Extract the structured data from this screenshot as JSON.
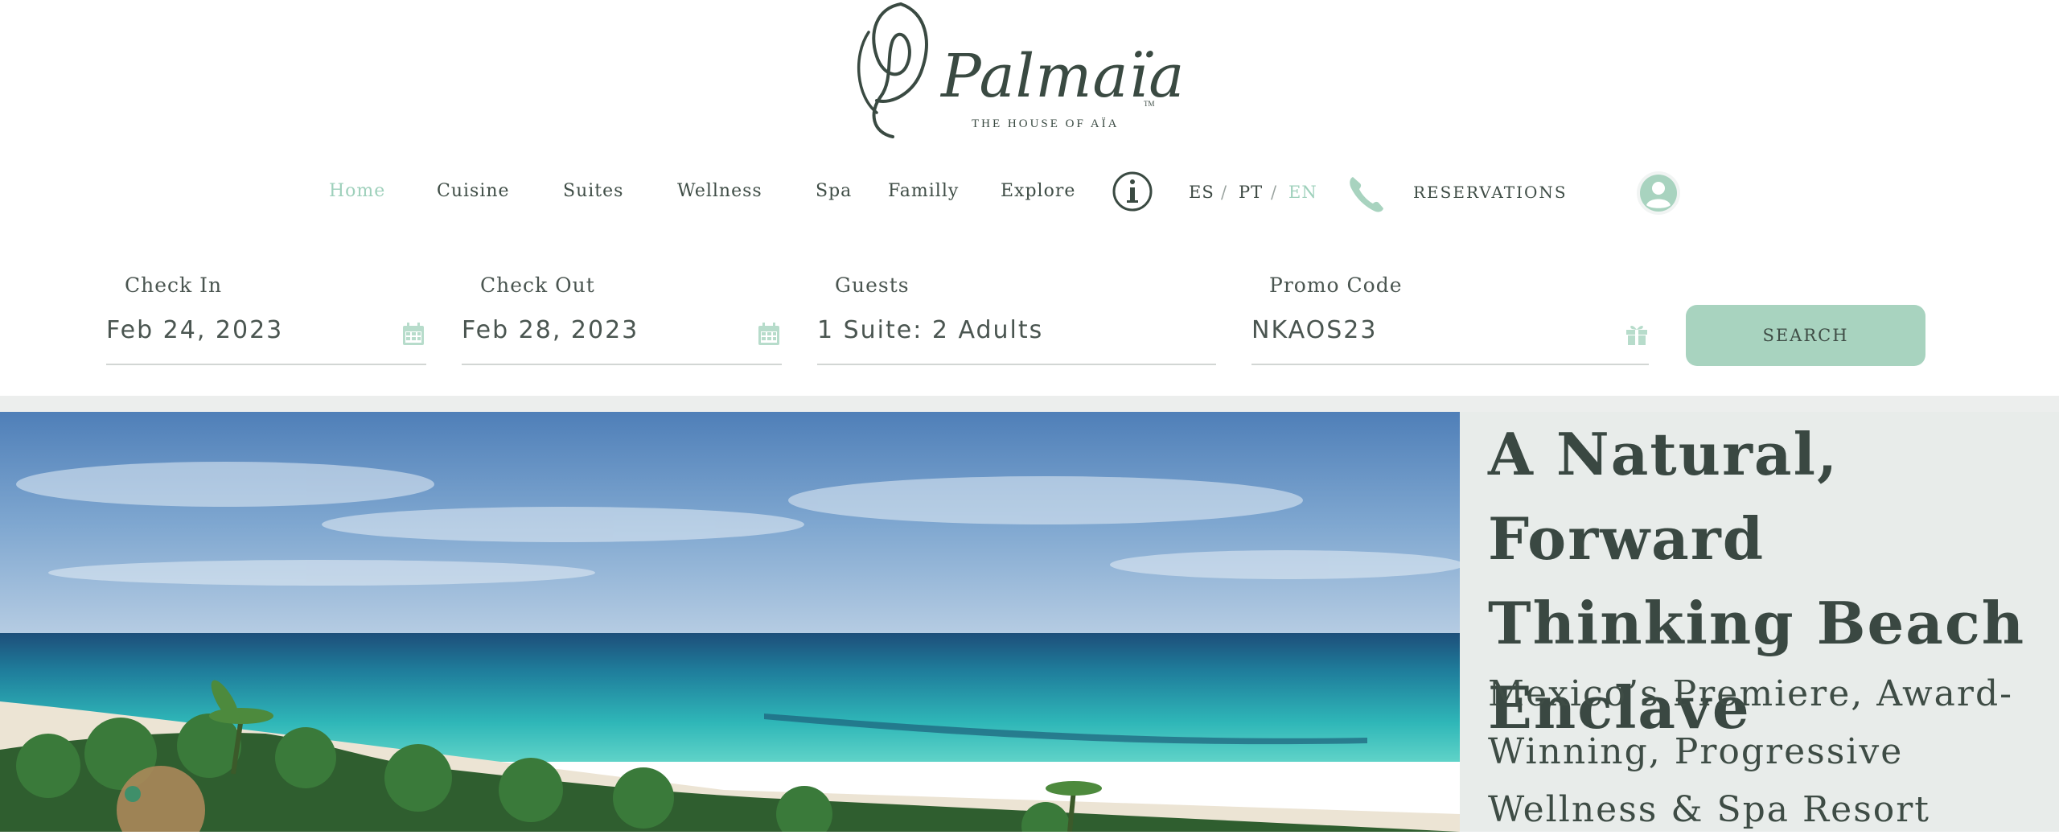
{
  "brand": {
    "logo_text": "Palmaïa",
    "tagline": "THE HOUSE OF AÏA",
    "trademark": "TM"
  },
  "nav": {
    "items": [
      {
        "label": "Home",
        "active": true
      },
      {
        "label": "Cuisine"
      },
      {
        "label": "Suites"
      },
      {
        "label": "Wellness"
      },
      {
        "label": "Spa"
      },
      {
        "label": "Familly"
      },
      {
        "label": "Explore"
      }
    ],
    "info_icon": "info-icon",
    "languages": [
      {
        "code": "ES"
      },
      {
        "code": "PT"
      },
      {
        "code": "EN",
        "active": true
      }
    ],
    "lang_separator": "/",
    "phone_icon": "phone-icon",
    "reservations_label": "RESERVATIONS",
    "account_icon": "user-avatar-icon"
  },
  "booking": {
    "check_in": {
      "label": "Check In",
      "value": "Feb 24, 2023",
      "icon": "calendar-icon"
    },
    "check_out": {
      "label": "Check Out",
      "value": "Feb 28, 2023",
      "icon": "calendar-icon"
    },
    "guests": {
      "label": "Guests",
      "value": "1 Suite: 2 Adults"
    },
    "promo": {
      "label": "Promo Code",
      "value": "NKAOS23",
      "icon": "gift-icon"
    },
    "search_label": "SEARCH"
  },
  "hero": {
    "headline": "A Natural, Forward Thinking Beach Enclave",
    "subheadline": "Mexico’s Premiere, Award-Winning, Progressive Wellness & Spa Resort"
  },
  "colors": {
    "accent": "#a8d3bf",
    "active_text": "#9ed0bb",
    "text": "#3e4a44",
    "panel_bg": "#e8ecea"
  }
}
